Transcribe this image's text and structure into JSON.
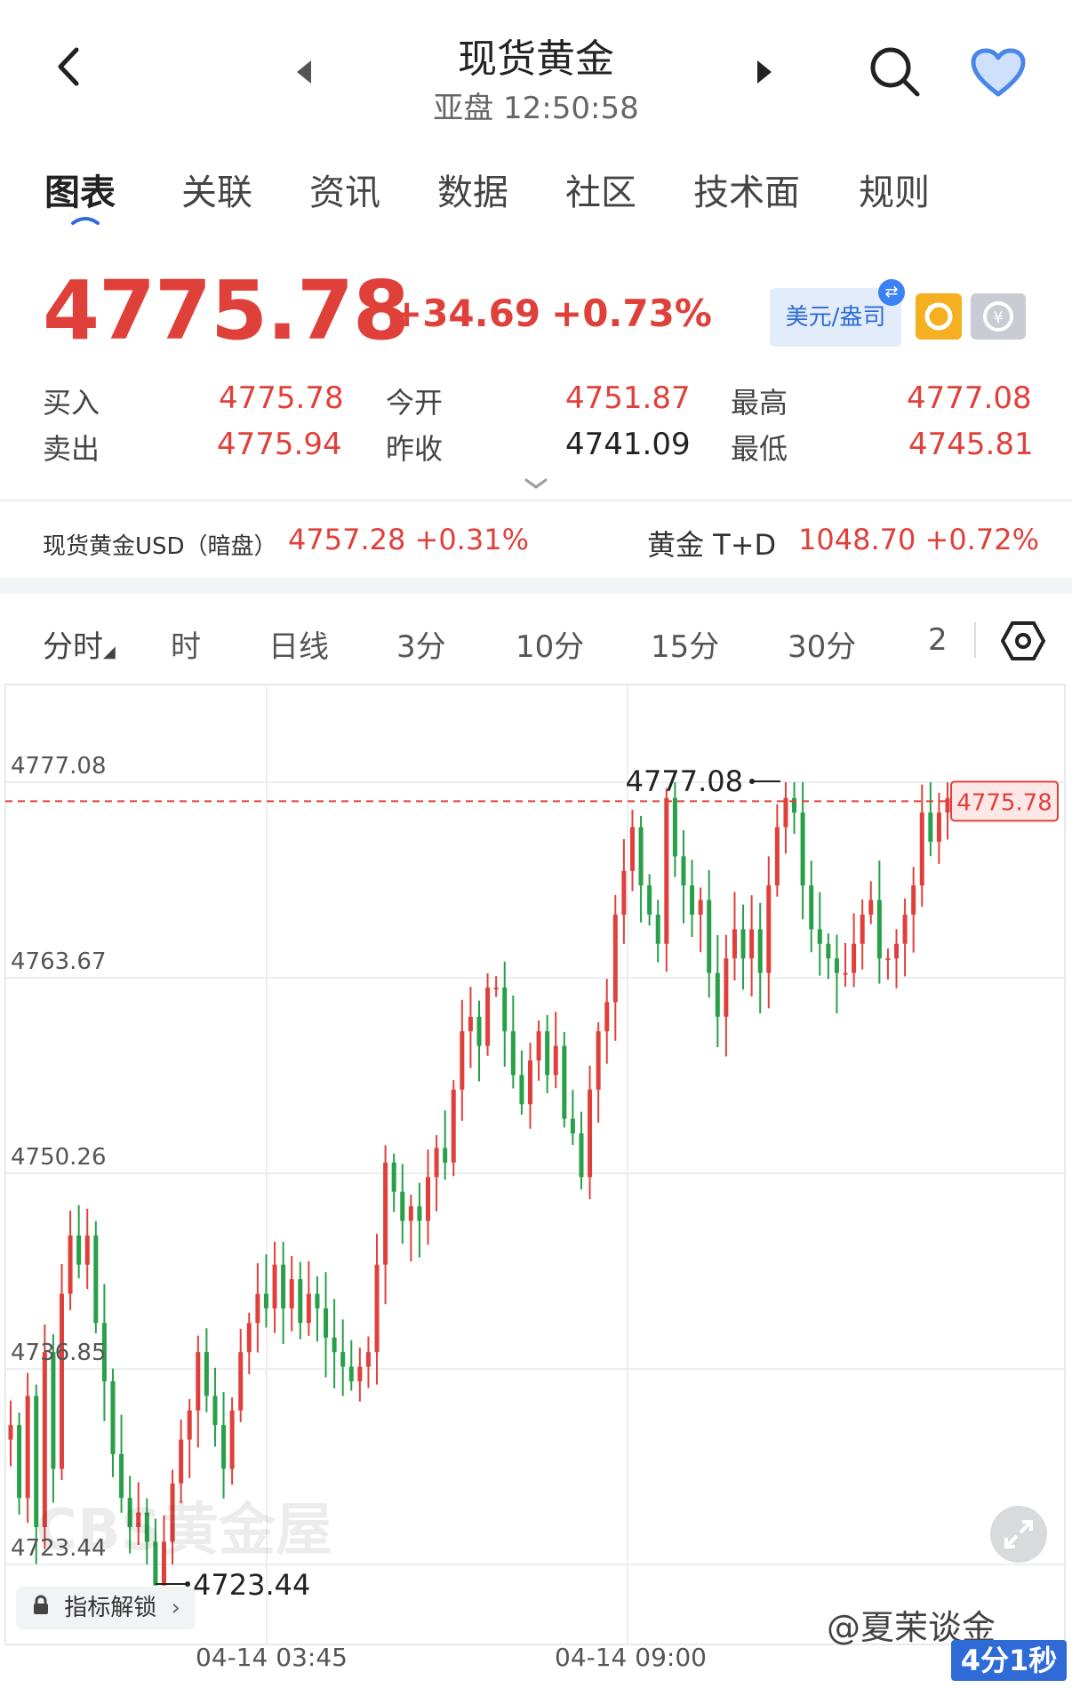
{
  "header": {
    "title": "现货黄金",
    "subtitle": "亚盘 12:50:58"
  },
  "tabs": [
    "图表",
    "关联",
    "资讯",
    "数据",
    "社区",
    "技术面",
    "规则"
  ],
  "price": {
    "last": "4775.78",
    "change": "+34.69",
    "change_pct": "+0.73%",
    "currency_label": "美元/盎司"
  },
  "stats": {
    "buy_label": "买入",
    "buy": "4775.78",
    "sell_label": "卖出",
    "sell": "4775.94",
    "open_label": "今开",
    "open": "4751.87",
    "prev_close_label": "昨收",
    "prev_close": "4741.09",
    "high_label": "最高",
    "high": "4777.08",
    "low_label": "最低",
    "low": "4745.81"
  },
  "related": {
    "left_name": "现货黄金USD（暗盘）",
    "left_value": "4757.28 +0.31%",
    "right_name": "黄金 T+D",
    "right_value": "1048.70 +0.72%"
  },
  "periods": [
    "分时",
    "时",
    "日线",
    "3分",
    "10分",
    "15分",
    "30分",
    "2"
  ],
  "chart_data": {
    "type": "candlestick",
    "y_ticks": [
      "4777.08",
      "4763.67",
      "4750.26",
      "4736.85",
      "4723.44"
    ],
    "ylim": [
      4723.44,
      4777.08
    ],
    "x_ticks": [
      "04-14 03:45",
      "04-14 09:00"
    ],
    "high_marker": "4777.08",
    "low_marker": "4723.44",
    "last_price_label": "4775.78",
    "grid": true,
    "colors": {
      "up": "#e0403a",
      "down": "#27a048",
      "last_line": "#e0403a"
    },
    "close_path": [
      4733,
      4728,
      4735,
      4726,
      4738,
      4730,
      4742,
      4746,
      4744,
      4746,
      4740,
      4736,
      4731,
      4728,
      4726,
      4727,
      4725,
      4722,
      4725,
      4729,
      4732,
      4734,
      4738,
      4735,
      4733,
      4730,
      4734,
      4738,
      4740,
      4742,
      4741,
      4744,
      4741,
      4743,
      4740,
      4742,
      4741,
      4739,
      4738,
      4737,
      4736,
      4737,
      4738,
      4744,
      4751,
      4749,
      4747,
      4748,
      4747,
      4750,
      4752,
      4751,
      4756,
      4760,
      4761,
      4759,
      4763,
      4763,
      4760,
      4757,
      4755,
      4758,
      4760,
      4757,
      4759,
      4754,
      4753,
      4750,
      4756,
      4760,
      4762,
      4768,
      4771,
      4774,
      4770,
      4768,
      4766,
      4776,
      4772,
      4770,
      4768,
      4769,
      4764,
      4761,
      4765,
      4767,
      4765,
      4767,
      4764,
      4770,
      4774,
      4776,
      4775,
      4770,
      4767,
      4766,
      4765,
      4764,
      4764,
      4766,
      4768,
      4769,
      4765,
      4765,
      4766,
      4768,
      4770,
      4775,
      4773,
      4775,
      4776
    ]
  },
  "unlock_label": "指标解锁",
  "watermark": "@夏茉谈金",
  "timer": "4分1秒"
}
